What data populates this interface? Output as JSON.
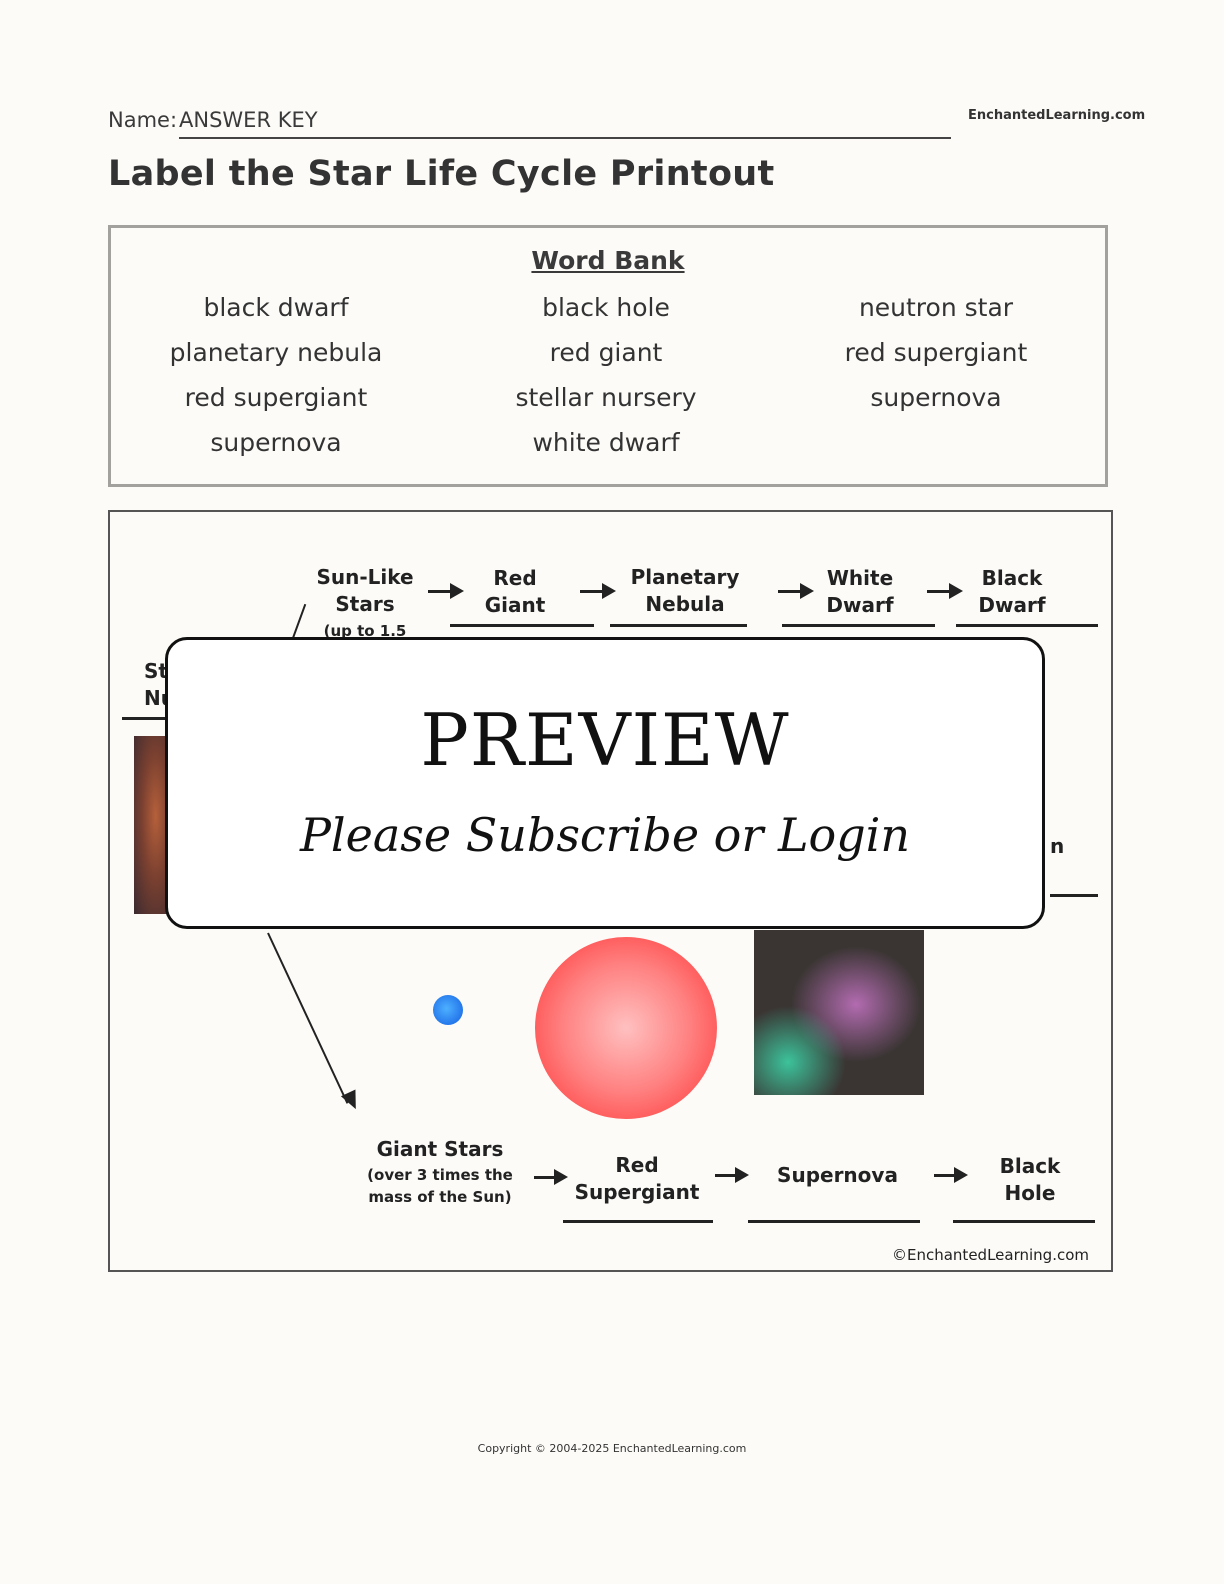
{
  "header": {
    "name_label": "Name:",
    "name_value": "ANSWER KEY",
    "site_brand": "EnchantedLearning.com",
    "title": "Label the Star Life Cycle Printout"
  },
  "word_bank": {
    "title": "Word Bank",
    "columns": [
      [
        "black dwarf",
        "planetary nebula",
        "red supergiant",
        "supernova"
      ],
      [
        "black hole",
        "red giant",
        "stellar nursery",
        "white dwarf"
      ],
      [
        "neutron star",
        "red supergiant",
        "supernova"
      ]
    ]
  },
  "diagram": {
    "top_row": {
      "start": [
        "Sun-Like",
        "Stars"
      ],
      "start_note": "(up to 1.5",
      "stages": [
        [
          "Red",
          "Giant"
        ],
        [
          "Planetary",
          "Nebula"
        ],
        [
          "White",
          "Dwarf"
        ],
        [
          "Black",
          "Dwarf"
        ]
      ]
    },
    "left_partial": [
      "St",
      "Nu"
    ],
    "right_partial": "n",
    "bottom_row": {
      "start": "Giant Stars",
      "start_note": [
        "(over 3 times the",
        "mass of the Sun)"
      ],
      "stages": [
        [
          "Red",
          "Supergiant"
        ],
        [
          "Supernova"
        ],
        [
          "Black",
          "Hole"
        ]
      ]
    },
    "credit": "©EnchantedLearning.com",
    "colors": {
      "blue_star": "#1f6fe8",
      "red_giant": "#ff5050"
    }
  },
  "preview": {
    "title": "PREVIEW",
    "subtitle": "Please Subscribe or Login"
  },
  "footer": {
    "copyright": "Copyright © 2004-2025 EnchantedLearning.com"
  }
}
